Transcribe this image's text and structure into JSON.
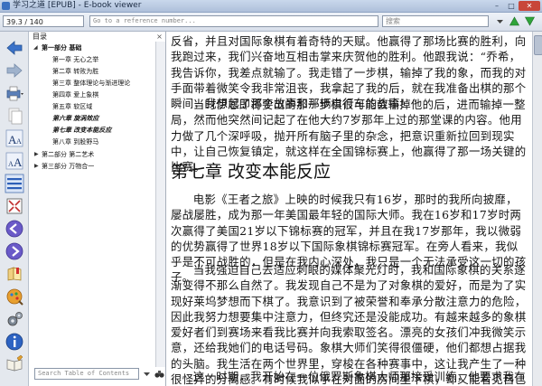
{
  "window": {
    "title": "学习之道 [EPUB] - E-book viewer",
    "controls": {
      "minimize": "–",
      "maximize": "□",
      "close": "✕"
    }
  },
  "toolbar": {
    "page_value": "39.3 / 140",
    "reference_placeholder": "Go to a reference number...",
    "search_placeholder": "搜索"
  },
  "sidebar_icons": [
    "back-icon",
    "forward-icon",
    "print-icon",
    "copy-icon",
    "font-larger-icon",
    "font-smaller-icon",
    "toc-icon",
    "fullscreen-icon",
    "previous-page-icon",
    "next-page-icon",
    "bookmark-icon",
    "reference-icon",
    "preferences-icon",
    "info-icon",
    "open-book-icon"
  ],
  "toc": {
    "header": "目录",
    "close": "×",
    "search_placeholder": "Search Table of Contents",
    "items": [
      {
        "label": "第一部分 基础",
        "level": 0,
        "expanded": true,
        "style": "bold"
      },
      {
        "label": "第一章 无心之举",
        "level": 1,
        "style": "normal"
      },
      {
        "label": "第二章 转败为胜",
        "level": 1,
        "style": "normal"
      },
      {
        "label": "第三章 整体理论与渐进理论",
        "level": 1,
        "style": "normal"
      },
      {
        "label": "第四章 爱上象棋",
        "level": 1,
        "style": "normal"
      },
      {
        "label": "第五章 软区域",
        "level": 1,
        "style": "normal"
      },
      {
        "label": "第六章 旋涡效应",
        "level": 1,
        "style": "italic"
      },
      {
        "label": "第七章 改变本能反应",
        "level": 1,
        "style": "italic"
      },
      {
        "label": "第八章 到股野马",
        "level": 1,
        "style": "normal"
      },
      {
        "label": "第二部分 第二艺术",
        "level": 0,
        "expanded": false,
        "style": "normal"
      },
      {
        "label": "第三部分 万物合一",
        "level": 0,
        "expanded": false,
        "style": "normal"
      }
    ]
  },
  "book": {
    "para1": "反省，并且对国际象棋有着奇特的天赋。他赢得了那场比赛的胜利，向我跑过来，我们兴奋地互相击掌来庆贺他的胜利。他跟我说：“乔希，我告诉你，我差点就输了。我走错了一步棋，输掉了我的象，而我的对手面带着微笑令我非常沮丧，我拿起了我的后，就在我准备出棋的那个瞬间，我想起了那个故事和那辆自行车的故事！”",
    "para2": "当时伊恩即将要出的那一步棋很可能会输掉他的后，进而输掉一整局，然而他突然间记起了在他大约7岁那年上过的那堂课的内容。他用力做了几个深呼吸，抛开所有脑子里的杂念，把意识重新拉回到现实中，让自己恢复镇定，就这样在全国锦标赛上，他赢得了那一场关键的比赛。",
    "chapter_heading": "第七章 改变本能反应",
    "para3": "电影《王者之旅》上映的时候我只有16岁，那时的我所向披靡，屡战屡胜，成为那一年美国最年轻的国际大师。我在16岁和17岁时两次赢得了美国21岁以下锦标赛的冠军，并且在我17岁那年，我以微弱的优势赢得了世界18岁以下国际象棋锦标赛冠军。在旁人看来，我似乎是不可战胜的，但是在我内心深处，我只是一个无法承受这一切的孩子。",
    "para4": "当我强迫自己去适应刺眼的媒体聚光灯时，我和国际象棋的关系逐渐变得不那么自然了。我发现自己不是为了对象棋的爱好，而是为了实现好莱坞梦想而下棋了。我意识到了被荣誉和奉承分散注意力的危险，因此我努力想要集中注意力，但终究还是没能成功。有越来越多的象棋爱好者们到赛场来看我比赛并向我索取签名。漂亮的女孩们冲我微笑示意，还给我她们的电话号码。象棋大师们笑得很僵硬，他们都想占据我的头脑。我生活在两个世界里，穿梭在各种赛事中，这让我产生了一种很怪异的分离感。有时候我似乎在对面的房间里下棋，却又能看见自己在思考。",
    "para5": "这一时期，我开始在一位俄罗斯象棋大师那接受训练，他要求我在国际象棋比赛中…"
  }
}
